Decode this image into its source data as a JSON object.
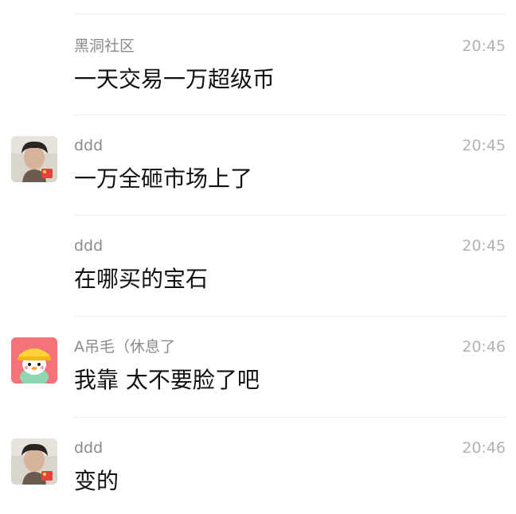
{
  "messages": [
    {
      "sender": "黑洞社区",
      "time": "20:45",
      "text": "一天交易一万超级币",
      "avatar": "none"
    },
    {
      "sender": "ddd",
      "time": "20:45",
      "text": "一万全砸市场上了",
      "avatar": "photo-avatar-icon"
    },
    {
      "sender": "ddd",
      "time": "20:45",
      "text": "在哪买的宝石",
      "avatar": "none"
    },
    {
      "sender": "A吊毛（休息了",
      "time": "20:46",
      "text": "我靠 太不要脸了吧",
      "avatar": "cartoon-duck-avatar-icon"
    },
    {
      "sender": "ddd",
      "time": "20:46",
      "text": "变的",
      "avatar": "photo-avatar-icon"
    }
  ]
}
